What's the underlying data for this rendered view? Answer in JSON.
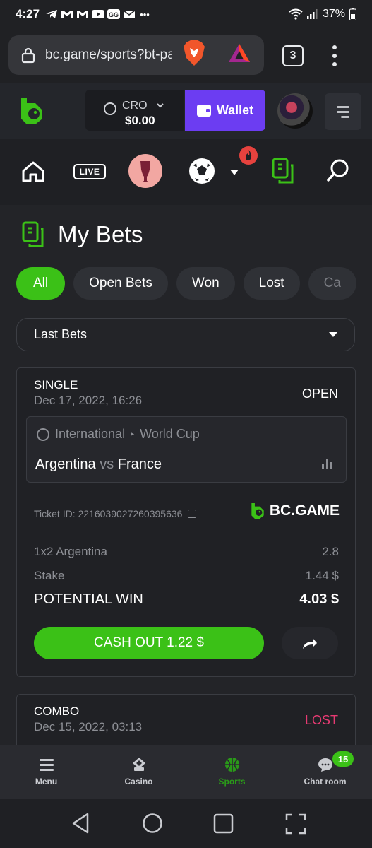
{
  "status_bar": {
    "time": "4:27",
    "battery": "37%",
    "notif_icons": [
      "telegram-icon",
      "gmail-icon",
      "gmail-icon",
      "youtube-icon",
      "gg-icon",
      "mail-icon",
      "more-icon"
    ]
  },
  "browser": {
    "url": "bc.game/sports?bt-pat",
    "tab_count": "3"
  },
  "header": {
    "currency": "CRO",
    "balance": "$0.00",
    "wallet_label": "Wallet"
  },
  "nav": {
    "live_label": "LIVE"
  },
  "page": {
    "title": "My Bets",
    "filters": [
      "All",
      "Open Bets",
      "Won",
      "Lost",
      "Ca"
    ],
    "active_filter": "All",
    "select_value": "Last Bets"
  },
  "bets": [
    {
      "type": "SINGLE",
      "date": "Dec 17, 2022, 16:26",
      "status": "OPEN",
      "competition_country": "International",
      "competition_name": "World Cup",
      "home": "Argentina",
      "vs": "vs",
      "away": "France",
      "ticket_id": "Ticket ID: 2216039027260395636",
      "brand": "BC.GAME",
      "selection_label": "1x2 Argentina",
      "selection_odds": "2.8",
      "stake_label": "Stake",
      "stake_value": "1.44 $",
      "potential_label": "POTENTIAL WIN",
      "potential_value": "4.03 $",
      "cashout_label": "CASH OUT 1.22 $"
    },
    {
      "type": "COMBO",
      "date": "Dec 15, 2022, 03:13",
      "status": "LOST"
    }
  ],
  "bottom_nav": {
    "items": [
      {
        "label": "Menu",
        "icon": "hamburger-icon"
      },
      {
        "label": "Casino",
        "icon": "casino-icon"
      },
      {
        "label": "Sports",
        "icon": "sports-ball-icon"
      },
      {
        "label": "Chat room",
        "icon": "chat-icon"
      }
    ],
    "chat_badge": "15"
  },
  "colors": {
    "accent_green": "#3bc117",
    "wallet_purple": "#6c3df2",
    "lost_pink": "#e63a72"
  }
}
